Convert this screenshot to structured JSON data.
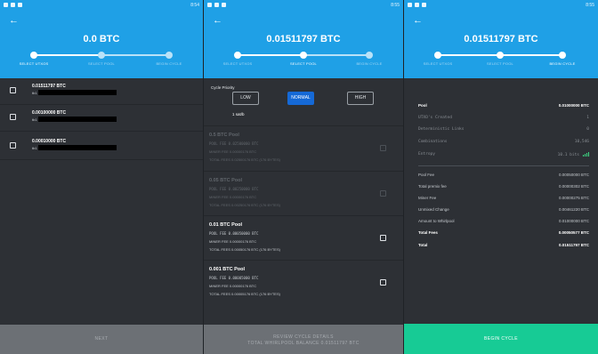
{
  "steps": [
    "SELECT UTXOS",
    "SELECT POOL",
    "BEGIN CYCLE"
  ],
  "screen1": {
    "time": "8:54",
    "amount": "0.0 BTC",
    "utxos": [
      {
        "value": "0.01511797 BTC",
        "addr": "tb1"
      },
      {
        "value": "0.00100000 BTC",
        "addr": "tb1"
      },
      {
        "value": "0.00010000 BTC",
        "addr": "tb1"
      }
    ],
    "button": "NEXT"
  },
  "screen2": {
    "time": "8:55",
    "amount": "0.01511797 BTC",
    "priority_title": "Cycle Priority",
    "priority": [
      "LOW",
      "NORMAL",
      "HIGH"
    ],
    "rate": "1 sat/b",
    "pools": [
      {
        "name": "0.5 BTC Pool",
        "pool_fee": "POOL FEE  0.02500000 BTC",
        "miner_fee": "MINER FEE  0.00000176 BTC",
        "total_fees": "TOTAL FEES  0.02500176 BTC (176 BYTES)"
      },
      {
        "name": "0.05 BTC Pool",
        "pool_fee": "POOL FEE  0.00250000 BTC",
        "miner_fee": "MINER FEE  0.00000176 BTC",
        "total_fees": "TOTAL FEES  0.00250176 BTC (176 BYTES)"
      },
      {
        "name": "0.01 BTC Pool",
        "pool_fee": "POOL FEE  0.00050000 BTC",
        "miner_fee": "MINER FEE  0.00000176 BTC",
        "total_fees": "TOTAL FEES  0.00050176 BTC (176 BYTES)"
      },
      {
        "name": "0.001 BTC Pool",
        "pool_fee": "POOL FEE  0.00005000 BTC",
        "miner_fee": "MINER FEE  0.00000176 BTC",
        "total_fees": "TOTAL FEES  0.00005176 BTC (176 BYTES)"
      }
    ],
    "button_line1": "REVIEW CYCLE DETAILS",
    "button_line2": "TOTAL WHIRLPOOL BALANCE 0.01511797 BTC"
  },
  "screen3": {
    "time": "8:55",
    "amount": "0.01511797 BTC",
    "pool_label": "Pool",
    "pool_value": "0.01000000 BTC",
    "metrics": [
      {
        "k": "UTXO's Created",
        "v": "1"
      },
      {
        "k": "Deterministic Links",
        "v": "0"
      },
      {
        "k": "Combinations",
        "v": "10,546"
      },
      {
        "k": "Entropy",
        "v": "10.1 bits"
      }
    ],
    "fees": [
      {
        "k": "Pool Fee",
        "v": "0.00050000 BTC"
      },
      {
        "k": "Total premix fee",
        "v": "0.00000302 BTC"
      },
      {
        "k": "Miner Fee",
        "v": "0.00000275 BTC"
      },
      {
        "k": "Unmixed Change",
        "v": "0.00461220 BTC"
      },
      {
        "k": "Amount to Whirlpool",
        "v": "0.01000000 BTC"
      }
    ],
    "total_fees_label": "Total Fees",
    "total_fees_value": "0.00050577 BTC",
    "total_label": "Total",
    "total_value": "0.01511797 BTC",
    "button": "BEGIN CYCLE"
  }
}
